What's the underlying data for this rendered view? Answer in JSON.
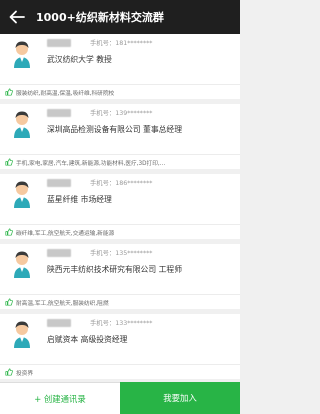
{
  "header": {
    "title": "1000+纺织新材料交流群",
    "back_icon": "arrow-left-icon"
  },
  "colors": {
    "header_bg": "#1f1f1f",
    "accent": "#28b446"
  },
  "members": [
    {
      "phone": "手机号：181********",
      "org": "武汉纺织大学   教授",
      "tags": "服装纺织,耐高温,保温,吸纤维,科研院校"
    },
    {
      "phone": "手机号：139********",
      "org": "深圳高品检测设备有限公司   董事总经理",
      "tags": "手机,家电,家居,汽车,建筑,新能源,功能材料,医疗,3D打印,..."
    },
    {
      "phone": "手机号：186********",
      "org": "蓝星纤维   市场经理",
      "tags": "碳纤维,军工,航空航天,交通运输,新能源"
    },
    {
      "phone": "手机号：135********",
      "org": "陕西元丰纺织技术研究有限公司   工程师",
      "tags": "耐高温,军工,航空航天,服装纺织,阻燃"
    },
    {
      "phone": "手机号：133********",
      "org": "启赋资本   高级投资经理",
      "tags": "投资界"
    }
  ],
  "bottom_bar": {
    "create_contacts": "+ 创建通讯录",
    "join": "我要加入"
  }
}
